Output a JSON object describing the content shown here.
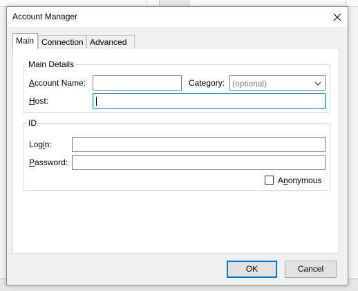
{
  "dialog": {
    "title": "Account Manager"
  },
  "tabs": [
    {
      "label": "Main",
      "active": true
    },
    {
      "label": "Connection",
      "active": false
    },
    {
      "label": "Advanced",
      "active": false
    }
  ],
  "main_details": {
    "legend": "Main Details",
    "account_name": {
      "label_prefix": "",
      "label_underline": "A",
      "label_rest": "ccount Name:",
      "value": ""
    },
    "category": {
      "label_prefix": "Cate",
      "label_underline": "g",
      "label_rest": "ory:",
      "placeholder": "(optional)"
    },
    "host": {
      "label_prefix": "",
      "label_underline": "H",
      "label_rest": "ost:",
      "value": ""
    }
  },
  "id_group": {
    "legend": "ID",
    "login": {
      "label_prefix": "Log",
      "label_underline": "i",
      "label_rest": "n:",
      "value": ""
    },
    "password": {
      "label_prefix": "",
      "label_underline": "P",
      "label_rest": "assword:",
      "value": ""
    },
    "anonymous": {
      "label_prefix": "A",
      "label_underline": "n",
      "label_rest": "onymous",
      "checked": false
    }
  },
  "buttons": {
    "ok": "OK",
    "cancel": "Cancel"
  },
  "colors": {
    "focus_accent": "#0078d7"
  }
}
